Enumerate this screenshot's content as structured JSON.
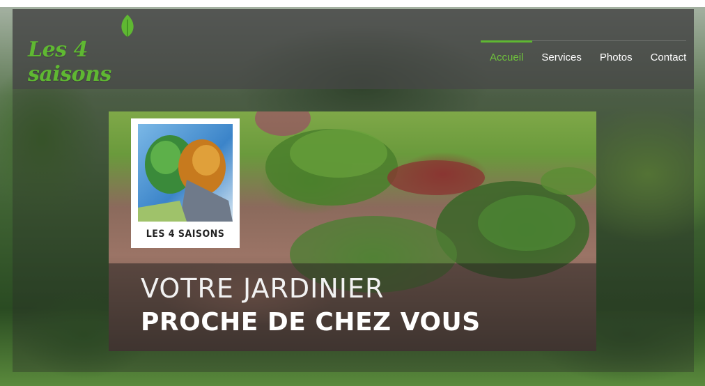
{
  "logo": {
    "text": "Les 4 saisons",
    "color": "#5fb832"
  },
  "nav": {
    "items": [
      {
        "label": "Accueil",
        "active": true
      },
      {
        "label": "Services",
        "active": false
      },
      {
        "label": "Photos",
        "active": false
      },
      {
        "label": "Contact",
        "active": false
      }
    ],
    "accent": "#5fb832"
  },
  "hero": {
    "line1": "VOTRE JARDINIER",
    "line2": "PROCHE DE CHEZ VOUS"
  },
  "badge": {
    "text": "LES 4 SAISONS"
  }
}
